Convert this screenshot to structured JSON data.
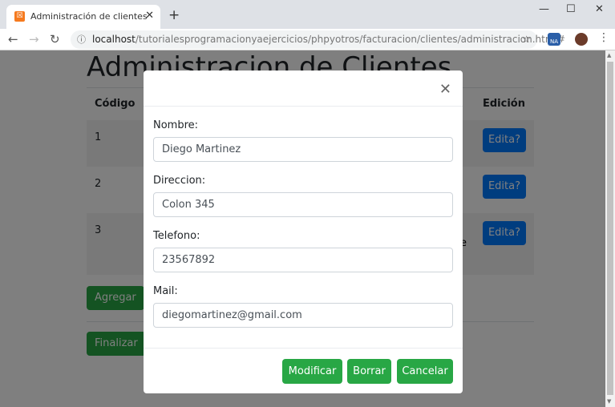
{
  "browser": {
    "tab_title": "Administración de clientes",
    "url_host": "localhost",
    "url_path": "/tutorialesprogramacionyaejercicios/phpyotros/facturacion/clientes/administracion.html#",
    "ext_label": "NA"
  },
  "page": {
    "title": "Administracion de Clientes",
    "columns": {
      "code": "Código",
      "edit": "Edición"
    },
    "rows": [
      {
        "code": "1",
        "edit": "Edita?"
      },
      {
        "code": "2",
        "edit": "Edita?"
      },
      {
        "code": "3",
        "edit": "Edita?",
        "partial_text": "e"
      }
    ],
    "add_label": "Agregar",
    "finish_label": "Finalizar"
  },
  "modal": {
    "fields": [
      {
        "label": "Nombre:",
        "value": "Diego Martinez"
      },
      {
        "label": "Direccion:",
        "value": "Colon 345"
      },
      {
        "label": "Telefono:",
        "value": "23567892"
      },
      {
        "label": "Mail:",
        "value": "diegomartinez@gmail.com"
      }
    ],
    "buttons": {
      "modify": "Modificar",
      "delete": "Borrar",
      "cancel": "Cancelar"
    }
  },
  "colors": {
    "primary": "#007bff",
    "success": "#28a745"
  }
}
